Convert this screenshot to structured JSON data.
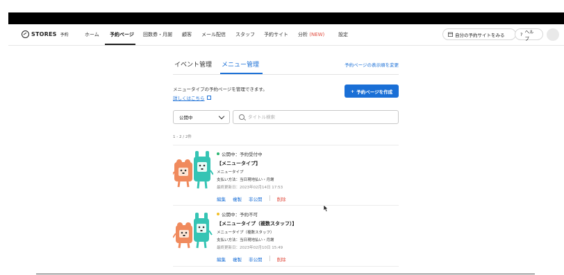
{
  "nav": {
    "brand": "STORES",
    "brand_sub": "予約",
    "items": [
      {
        "label": "ホーム"
      },
      {
        "label": "予約ページ"
      },
      {
        "label": "回数券・月謝"
      },
      {
        "label": "顧客"
      },
      {
        "label": "メール配信"
      },
      {
        "label": "スタッフ"
      },
      {
        "label": "予約サイト"
      },
      {
        "label": "分析"
      },
      {
        "label": "設定"
      }
    ],
    "new_badge": "(NEW)",
    "view_site_label": "自分の予約サイトをみる",
    "help_label": "ヘルプ"
  },
  "tabs": {
    "items": [
      {
        "label": "イベント管理"
      },
      {
        "label": "メニュー管理"
      }
    ],
    "sort_link": "予約ページの表示順を変更"
  },
  "main": {
    "description": "メニュータイプの予約ページを管理できます。",
    "help_link": "詳しくはこちら",
    "create_button": "予約ページを作成",
    "filter_value": "公開中",
    "search_placeholder": "タイトル検索",
    "count_text": "1 - 2 / 2件"
  },
  "cards": [
    {
      "status": "公開中：予約受付中",
      "title": "【メニュータイプ】",
      "type": "メニュータイプ",
      "payment": "支払い方法：当日現地払い・月謝",
      "updated": "最終更新日：2023年02月14日 17:53",
      "actions": {
        "edit": "編集",
        "copy": "複製",
        "unpublish": "非公開",
        "delete": "削除"
      }
    },
    {
      "status": "公開中：予約不可",
      "title": "【メニュータイプ（複数スタッフ）】",
      "type": "メニュータイプ（複数スタッフ）",
      "payment": "支払い方法：当日現地払い・月謝",
      "updated": "最終更新日：2023年02月10日 15:49",
      "actions": {
        "edit": "編集",
        "copy": "複製",
        "unpublish": "非公開",
        "delete": "削除"
      }
    }
  ],
  "colors": {
    "accent": "#1a6fd6",
    "status_open": "#2bb673",
    "status_closed": "#f2c028",
    "delete": "#e0493b",
    "new_badge": "#e0493b"
  },
  "icons": [
    "stores-logo-icon",
    "external-link-icon",
    "plus-icon",
    "chevron-down-icon",
    "search-icon",
    "calendar-icon",
    "help-icon",
    "cursor-icon"
  ]
}
